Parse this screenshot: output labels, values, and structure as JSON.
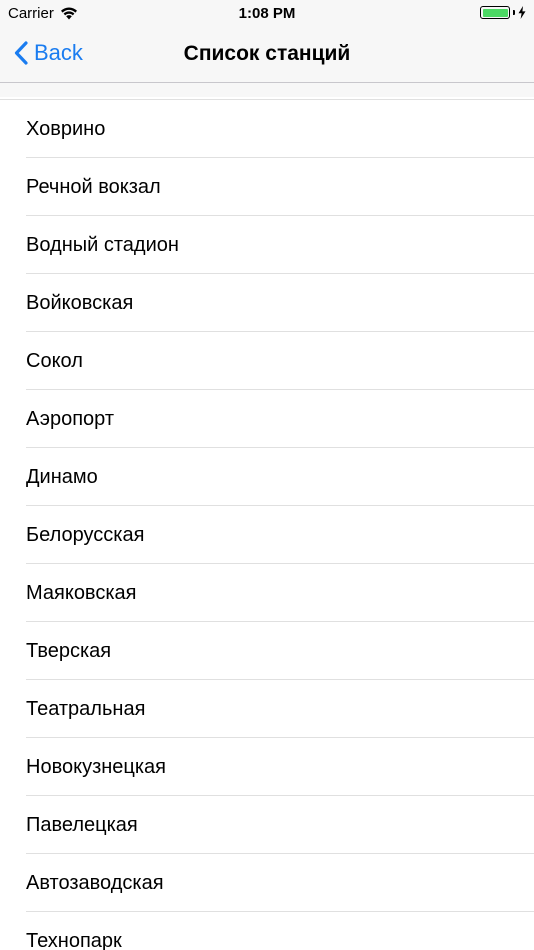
{
  "status_bar": {
    "carrier": "Carrier",
    "time": "1:08 PM",
    "battery_level": 1.0,
    "battery_color": "#4cd964"
  },
  "nav": {
    "back_label": "Back",
    "title": "Список станций",
    "accent_color": "#1a7cf0"
  },
  "stations": [
    "Ховрино",
    "Речной вокзал",
    "Водный стадион",
    "Войковская",
    "Сокол",
    "Аэропорт",
    "Динамо",
    "Белорусская",
    "Маяковская",
    "Тверская",
    "Театральная",
    "Новокузнецкая",
    "Павелецкая",
    "Автозаводская",
    "Технопарк"
  ]
}
